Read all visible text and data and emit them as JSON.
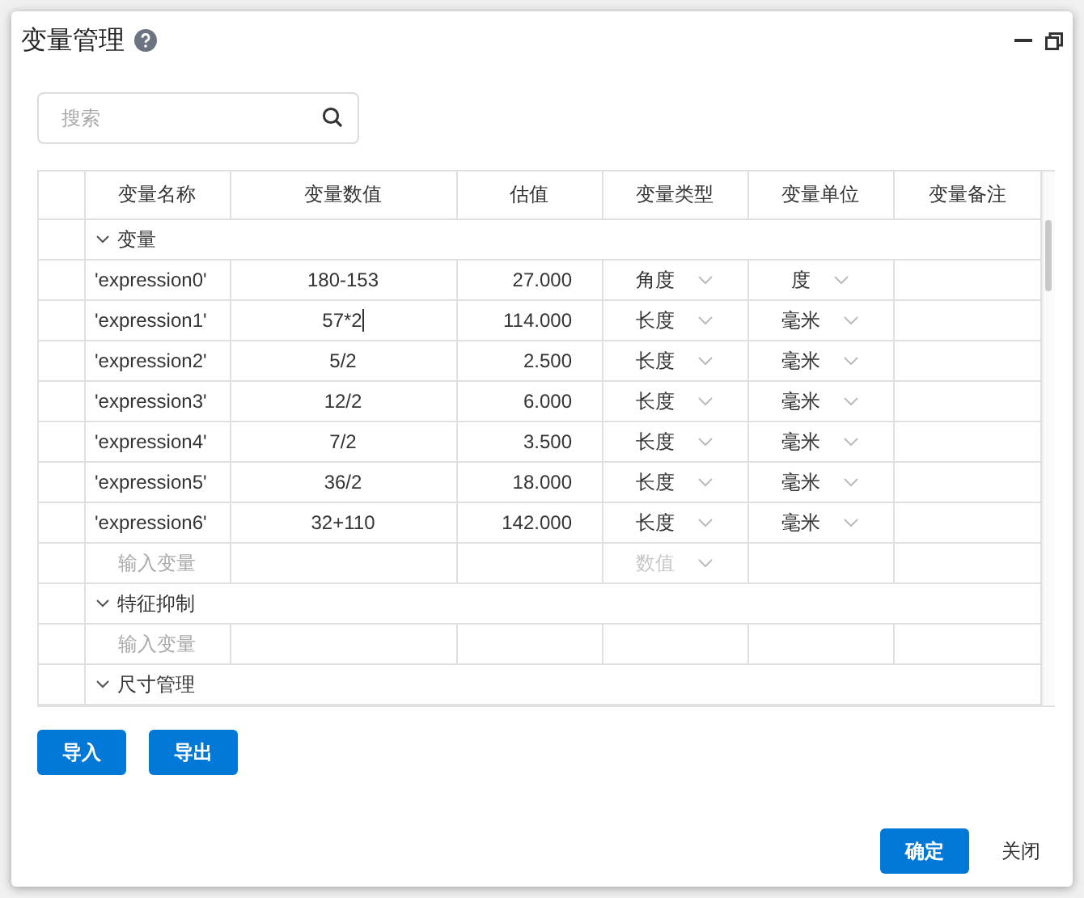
{
  "window": {
    "title": "变量管理"
  },
  "search": {
    "placeholder": "搜索"
  },
  "table": {
    "columns": [
      "变量名称",
      "变量数值",
      "估值",
      "变量类型",
      "变量单位",
      "变量备注"
    ],
    "groups": [
      {
        "label": "变量",
        "expanded": true,
        "children": [
          {
            "kind": "variable",
            "name": "'expression0'",
            "value": "180-153",
            "estimate": "27.000",
            "type": "角度",
            "unit": "度",
            "editing": false
          },
          {
            "kind": "variable",
            "name": "'expression1'",
            "value": "57*2",
            "estimate": "114.000",
            "type": "长度",
            "unit": "毫米",
            "editing": true
          },
          {
            "kind": "variable",
            "name": "'expression2'",
            "value": "5/2",
            "estimate": "2.500",
            "type": "长度",
            "unit": "毫米",
            "editing": false
          },
          {
            "kind": "variable",
            "name": "'expression3'",
            "value": "12/2",
            "estimate": "6.000",
            "type": "长度",
            "unit": "毫米",
            "editing": false
          },
          {
            "kind": "variable",
            "name": "'expression4'",
            "value": "7/2",
            "estimate": "3.500",
            "type": "长度",
            "unit": "毫米",
            "editing": false
          },
          {
            "kind": "variable",
            "name": "'expression5'",
            "value": "36/2",
            "estimate": "18.000",
            "type": "长度",
            "unit": "毫米",
            "editing": false
          },
          {
            "kind": "variable",
            "name": "'expression6'",
            "value": "32+110",
            "estimate": "142.000",
            "type": "长度",
            "unit": "毫米",
            "editing": false
          },
          {
            "kind": "input",
            "placeholder": "输入变量",
            "type_placeholder": "数值"
          }
        ]
      },
      {
        "label": "特征抑制",
        "expanded": true,
        "children": [
          {
            "kind": "input",
            "placeholder": "输入变量"
          }
        ]
      },
      {
        "label": "尺寸管理",
        "expanded": true
      }
    ]
  },
  "actions": [
    "导入",
    "导出"
  ],
  "footer": {
    "confirm": "确定",
    "close": "关闭"
  }
}
